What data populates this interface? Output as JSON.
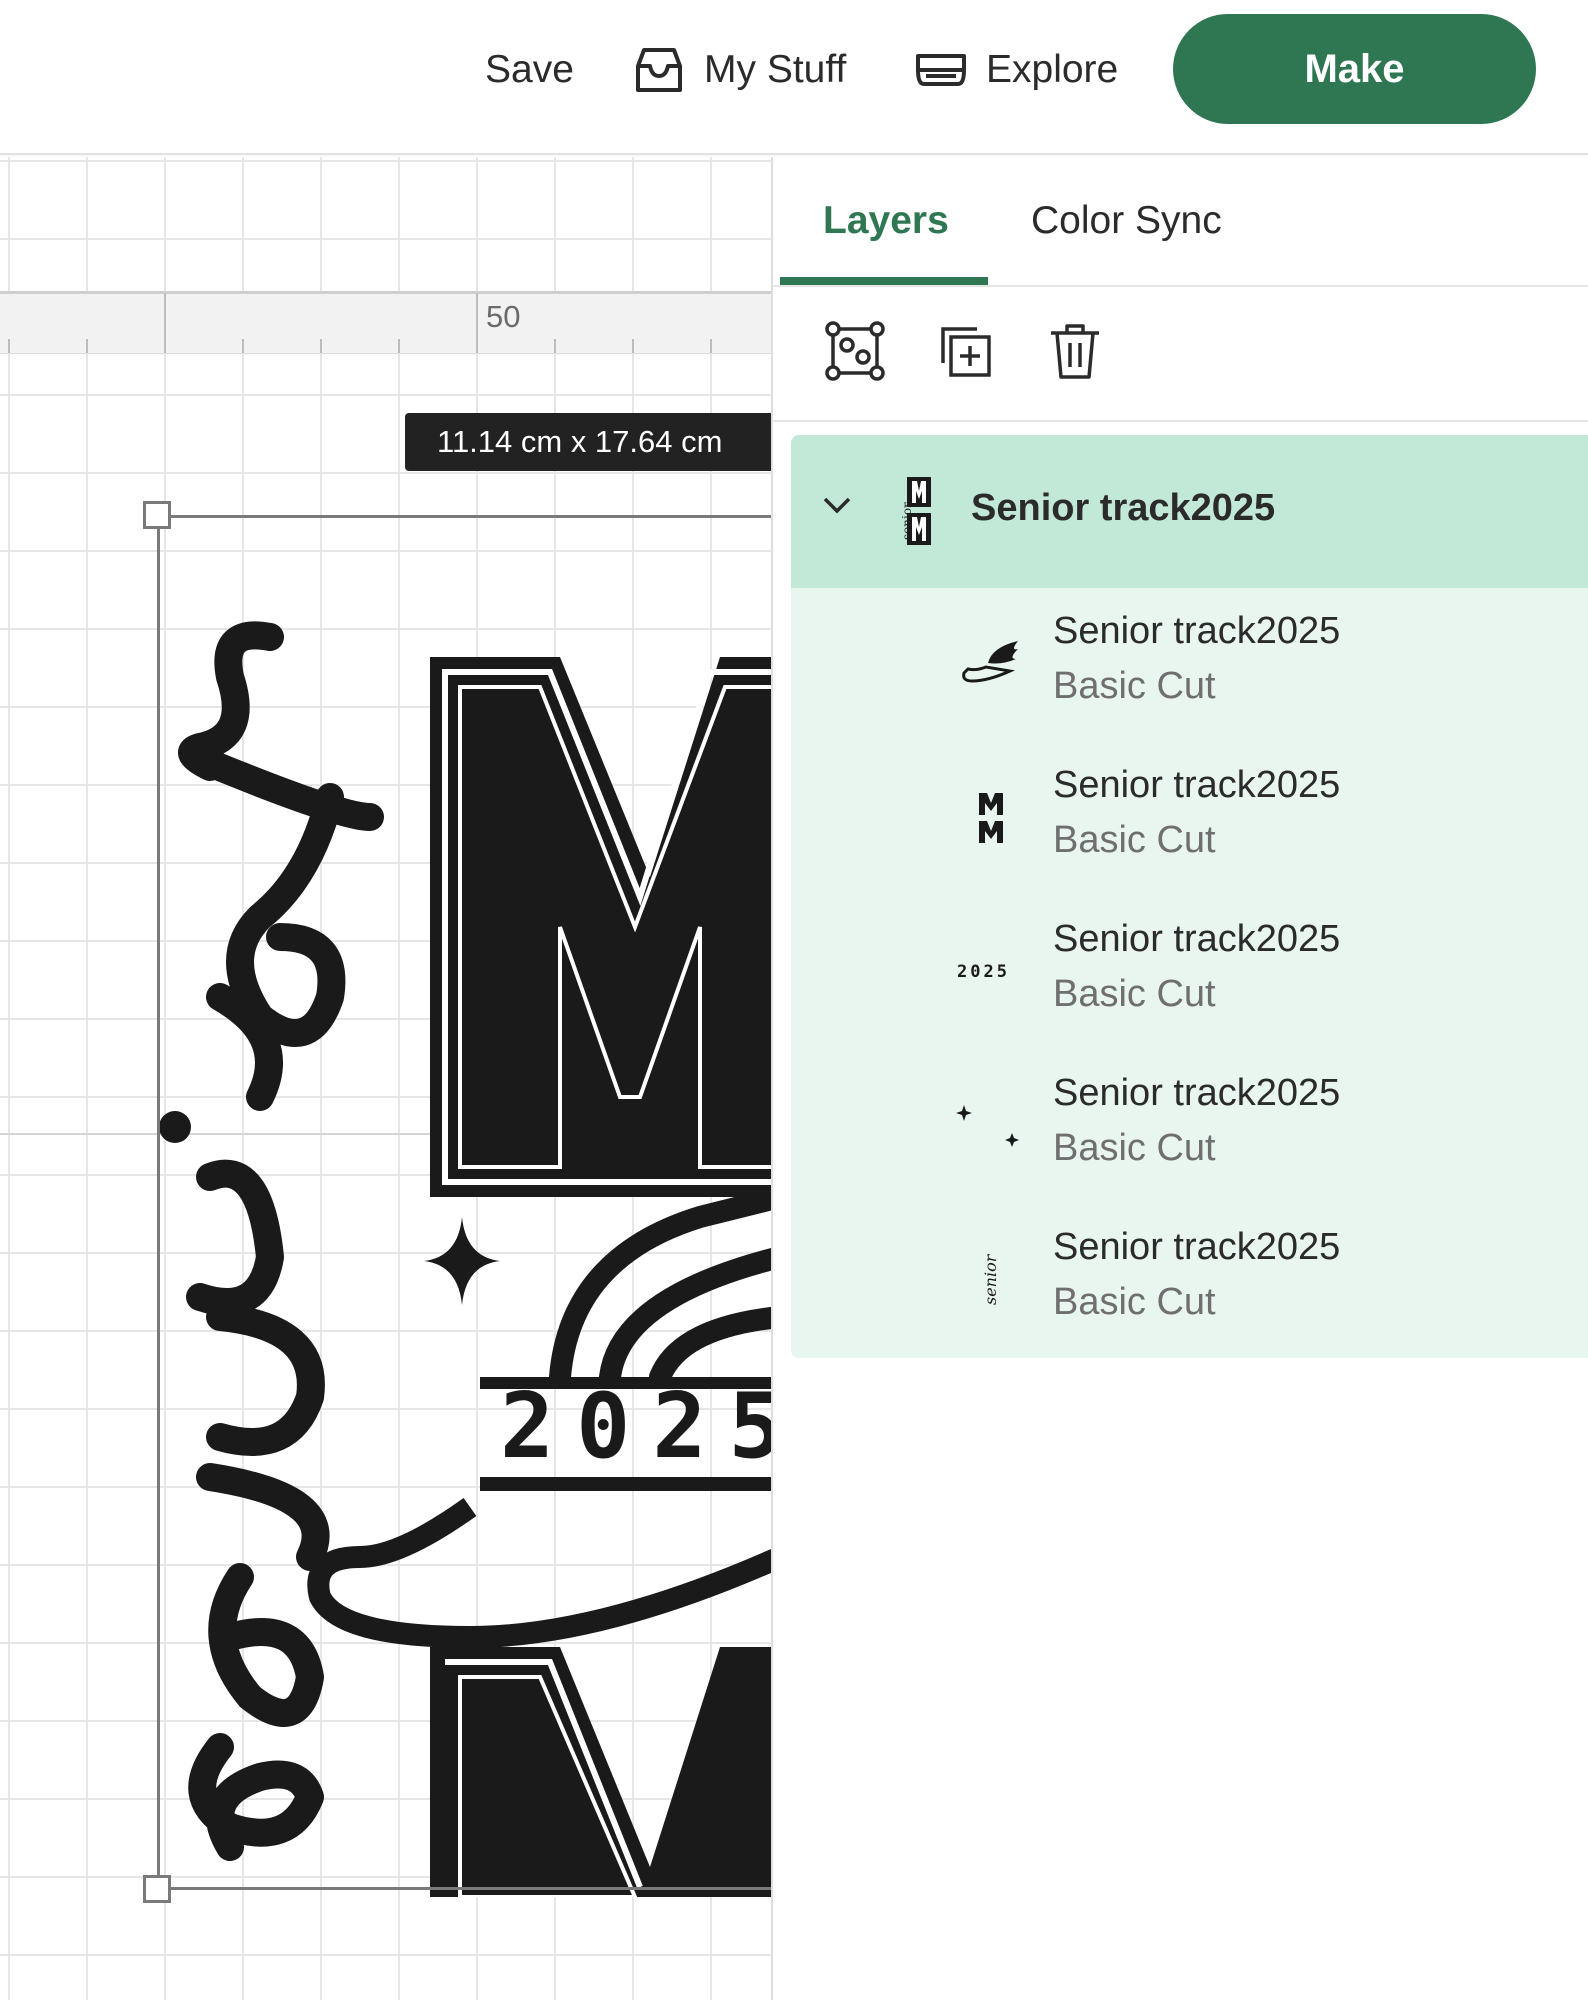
{
  "topbar": {
    "save_label": "Save",
    "mystuff_label": "My Stuff",
    "explore_label": "Explore",
    "make_label": "Make",
    "make_color": "#2f7752"
  },
  "canvas": {
    "ruler_label": "50",
    "dimensions": "11.14  cm x 17.64  cm",
    "design": {
      "script_text": "senior",
      "year_text": "2025"
    }
  },
  "panel": {
    "tabs": [
      {
        "label": "Layers",
        "active": true
      },
      {
        "label": "Color Sync",
        "active": false
      }
    ],
    "toolbar": [
      "group-icon",
      "duplicate-icon",
      "delete-icon"
    ],
    "group": {
      "title": "Senior track2025",
      "expanded": true,
      "color": "#c2e9d8"
    },
    "layers": [
      {
        "name": "Senior track2025",
        "operation": "Basic Cut",
        "thumb": "winged-shoe"
      },
      {
        "name": "Senior track2025",
        "operation": "Basic Cut",
        "thumb": "letter-m-pair"
      },
      {
        "name": "Senior track2025",
        "operation": "Basic Cut",
        "thumb": "year-2025",
        "thumb_text": "2025"
      },
      {
        "name": "Senior track2025",
        "operation": "Basic Cut",
        "thumb": "sparkles"
      },
      {
        "name": "Senior track2025",
        "operation": "Basic Cut",
        "thumb": "senior-script",
        "thumb_text": "senior"
      }
    ]
  }
}
